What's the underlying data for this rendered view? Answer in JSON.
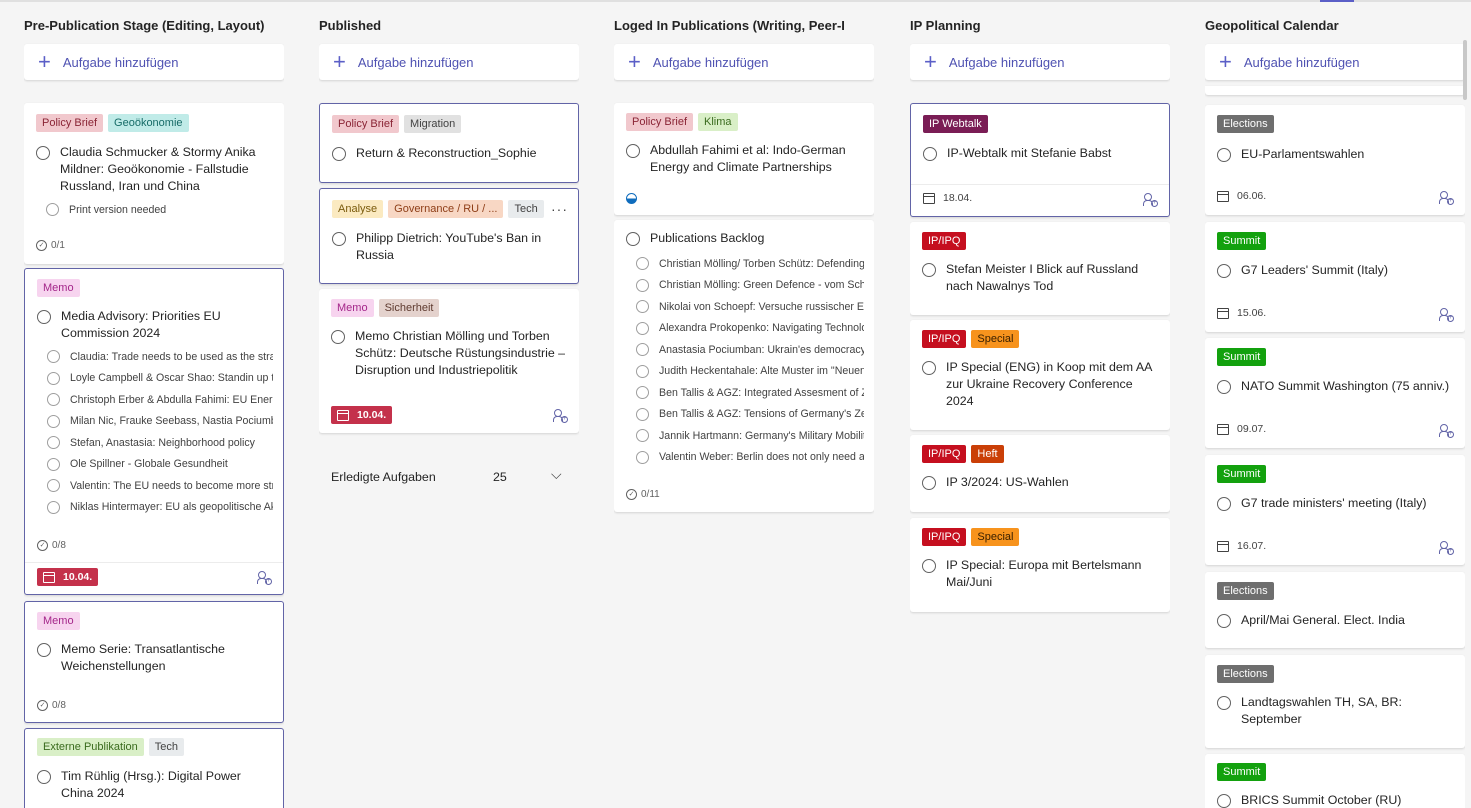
{
  "add_label": "Aufgabe hinzufügen",
  "colors": {
    "accent": "#5b5fc7",
    "red": "#c4314b"
  },
  "columns": {
    "c1": {
      "title": "Pre-Publication Stage (Editing, Layout)",
      "cards": {
        "a": {
          "l1": "Policy Brief",
          "l2": "Geoökonomie",
          "title": "Claudia Schmucker & Stormy Anika Mildner: Geoökonomie - Fallstudie Russland, Iran und China",
          "item1": "Print version needed",
          "progress": "0/1"
        },
        "b": {
          "l1": "Memo",
          "title": "Media Advisory: Priorities EU Commission 2024",
          "items": [
            "Claudia: Trade needs to be used as the strate",
            "Loyle Campbell & Oscar Shao: Standin up to",
            "Christoph Erber & Abdulla Fahimi: EU Energy",
            "Milan Nic, Frauke Seebass, Nastia Pociumbar",
            "Stefan, Anastasia: Neighborhood policy",
            "Ole Spillner - Globale Gesundheit",
            "Valentin: The EU needs to become more stra",
            "Niklas Hintermayer: EU als geopolitische Akt"
          ],
          "progress": "0/8",
          "due": "10.04."
        },
        "c": {
          "l1": "Memo",
          "title": "Memo Serie: Transatlantische Weichenstellungen",
          "progress": "0/8"
        },
        "d": {
          "l1": "Externe Publikation",
          "l2": "Tech",
          "title": "Tim Rühlig (Hrsg.): Digital Power China 2024"
        }
      }
    },
    "c2": {
      "title": "Published",
      "cards": {
        "a": {
          "l1": "Policy Brief",
          "l2": "Migration",
          "title": "Return & Reconstruction_Sophie"
        },
        "b": {
          "l1": "Analyse",
          "l2": "Governance / RU / ...",
          "l3": "Tech",
          "title": "Philipp Dietrich: YouTube's Ban in Russia",
          "more": "···"
        },
        "c": {
          "l1": "Memo",
          "l2": "Sicherheit",
          "title": "Memo Christian Mölling und Torben Schütz: Deutsche Rüstungsindustrie – Disruption und Industriepolitik",
          "due": "10.04."
        }
      },
      "completed": {
        "label": "Erledigte Aufgaben",
        "count": "25"
      }
    },
    "c3": {
      "title": "Loged In Publications (Writing, Peer-Review)",
      "cards": {
        "a": {
          "l1": "Policy Brief",
          "l2": "Klima",
          "title": "Abdullah Fahimi et al: Indo-German Energy and Climate Partnerships"
        },
        "b": {
          "title": "Publications Backlog",
          "items": [
            "Christian Mölling/ Torben Schütz: Defending",
            "Christian Mölling: Green Defence - vom Schla",
            "Nikolai von Schoepf: Versuche russischer Einf",
            "Alexandra Prokopenko: Navigating Technolog",
            "Anastasia Pociumban: Ukrain'es democracy a",
            "Judith Heckentahale: Alte Muster im \"Neuen",
            "Ben Tallis & AGZ: Integrated Assesment of Ze",
            "Ben Tallis & AGZ: Tensions of Germany's Zeite",
            "Jannik Hartmann: Germany's Military Mobility",
            "Valentin Weber: Berlin does not only need a s"
          ],
          "progress": "0/11"
        }
      }
    },
    "c4": {
      "title": "IP Planning",
      "cards": {
        "a": {
          "l1": "IP Webtalk",
          "title": "IP-Webtalk mit Stefanie Babst",
          "due": "18.04."
        },
        "b": {
          "l1": "IP/IPQ",
          "title": "Stefan Meister I Blick auf Russland nach Nawalnys Tod"
        },
        "c": {
          "l1": "IP/IPQ",
          "l2": "Special",
          "title": "IP Special (ENG) in Koop mit dem AA zur Ukraine Recovery Conference 2024"
        },
        "d": {
          "l1": "IP/IPQ",
          "l2": "Heft",
          "title": "IP 3/2024: US-Wahlen"
        },
        "e": {
          "l1": "IP/IPQ",
          "l2": "Special",
          "title": "IP Special: Europa mit Bertelsmann Mai/Juni"
        }
      }
    },
    "c5": {
      "title": "Geopolitical Calendar",
      "cards": {
        "a": {
          "l1": "Elections",
          "title": "EU-Parlamentswahlen",
          "due": "06.06."
        },
        "b": {
          "l1": "Summit",
          "title": "G7 Leaders' Summit (Italy)",
          "due": "15.06."
        },
        "c": {
          "l1": "Summit",
          "title": "NATO Summit Washington (75 anniv.)",
          "due": "09.07."
        },
        "d": {
          "l1": "Summit",
          "title": "G7 trade ministers' meeting (Italy)",
          "due": "16.07."
        },
        "e": {
          "l1": "Elections",
          "title": "April/Mai General. Elect. India"
        },
        "f": {
          "l1": "Elections",
          "title": "Landtagswahlen TH, SA, BR: September"
        },
        "g": {
          "l1": "Summit",
          "title": "BRICS Summit October (RU)"
        }
      }
    }
  }
}
